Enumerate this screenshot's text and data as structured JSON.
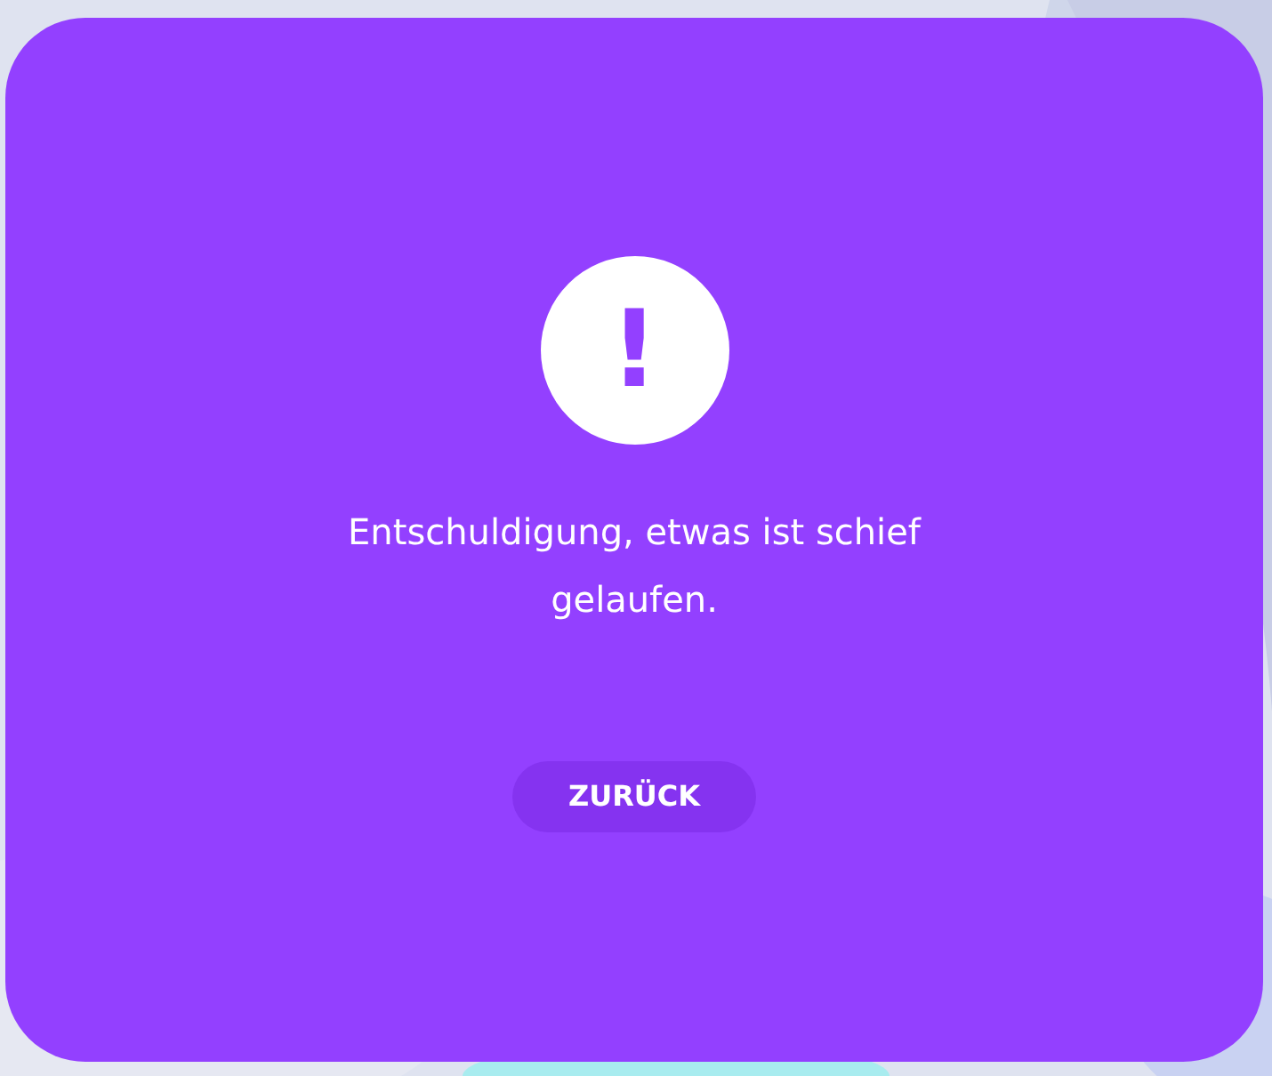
{
  "dialog": {
    "icon": "!",
    "message": "Entschuldigung, etwas ist schief gelaufen.",
    "button": "ZURÜCK"
  }
}
